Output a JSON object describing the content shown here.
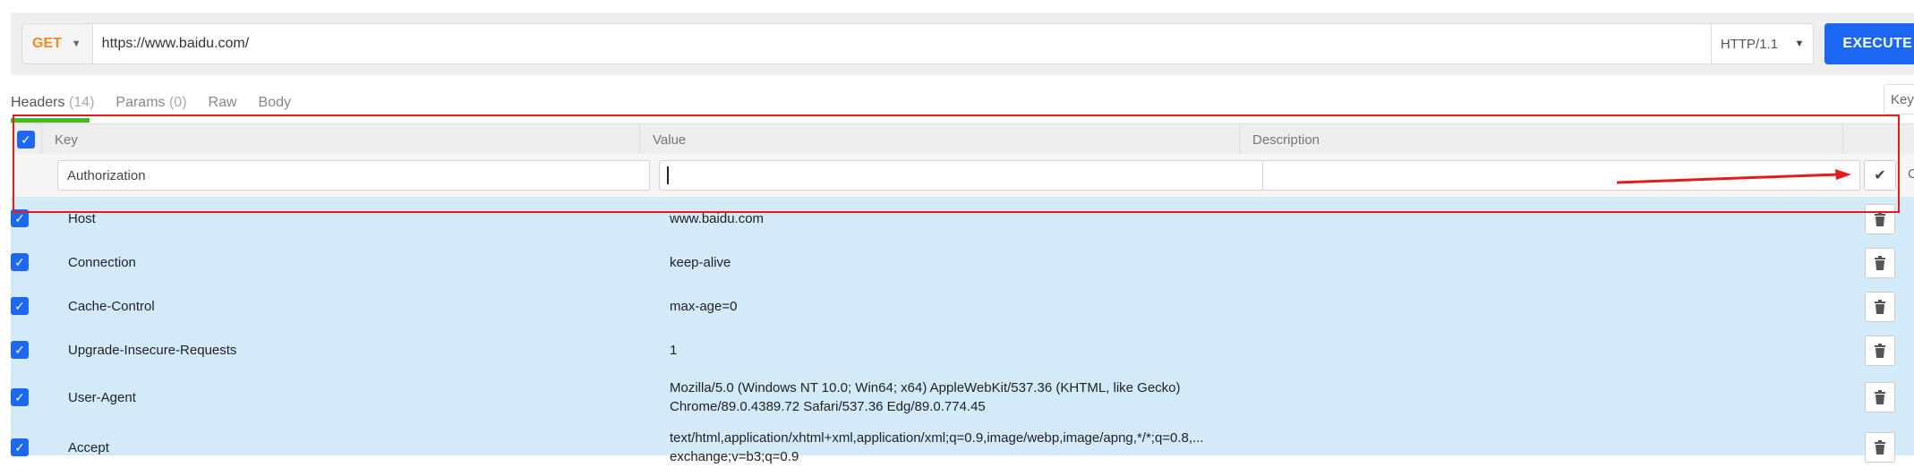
{
  "request": {
    "method": "GET",
    "url": "https://www.baidu.com/",
    "protocol": "HTTP/1.1",
    "execute_label": "EXECUTE"
  },
  "tabs": [
    {
      "label": "Headers",
      "count": "(14)"
    },
    {
      "label": "Params",
      "count": "(0)"
    },
    {
      "label": "Raw",
      "count": ""
    },
    {
      "label": "Body",
      "count": ""
    }
  ],
  "key_chip": "Key",
  "columns": {
    "key": "Key",
    "value": "Value",
    "description": "Description"
  },
  "edit_row": {
    "key": "Authorization",
    "value": "",
    "description": ""
  },
  "headers": [
    {
      "key": "Host",
      "value": "www.baidu.com"
    },
    {
      "key": "Connection",
      "value": "keep-alive"
    },
    {
      "key": "Cache-Control",
      "value": "max-age=0"
    },
    {
      "key": "Upgrade-Insecure-Requests",
      "value": "1"
    },
    {
      "key": "User-Agent",
      "value_line1": "Mozilla/5.0 (Windows NT 10.0; Win64; x64) AppleWebKit/537.36 (KHTML, like Gecko)",
      "value_line2": "Chrome/89.0.4389.72 Safari/537.36 Edg/89.0.774.45"
    },
    {
      "key": "Accept",
      "value_line1": "text/html,application/xhtml+xml,application/xml;q=0.9,image/webp,image/apng,*/*;q=0.8,...",
      "value_line2": "exchange;v=b3;q=0.9"
    }
  ],
  "edge_char": "C",
  "colors": {
    "accent": "#1b66f2",
    "method": "#f08a24",
    "active_tab": "#44bb22",
    "row_bg": "#d3ebf9",
    "annotation": "#e41b1b"
  },
  "icons": {
    "check": "check-icon",
    "trash": "trash-icon",
    "caret": "caret-down-icon"
  }
}
